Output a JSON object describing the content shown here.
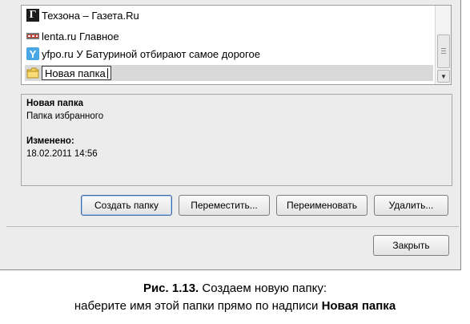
{
  "bookmarks": {
    "items": [
      {
        "label": "Техзона – Газета.Ru",
        "icon": "gazeta-favicon",
        "icon_glyph": "Г"
      },
      {
        "label": "lenta.ru Главное",
        "icon": "lenta-favicon"
      },
      {
        "label": "yfpo.ru У Батуриной отбирают самое дорогое",
        "icon": "yandex-favicon",
        "icon_glyph": "Y"
      }
    ],
    "new_folder": {
      "value": "Новая папка",
      "icon": "folder-icon"
    }
  },
  "details": {
    "name": "Новая папка",
    "description": "Папка избранного",
    "modified_label": "Изменено:",
    "modified_value": "18.02.2011 14:56"
  },
  "buttons": {
    "create": "Создать папку",
    "move": "Переместить...",
    "rename": "Переименовать",
    "delete": "Удалить...",
    "close": "Закрыть"
  },
  "caption": {
    "figure": "Рис. 1.13.",
    "line1_rest": " Создаем новую папку:",
    "line2_prefix": "наберите имя этой папки прямо по надписи ",
    "line2_bold": "Новая папка"
  },
  "colors": {
    "window_bg": "#ececec",
    "selection_bg": "#d9d9d9",
    "default_button_border": "#3b6ea8"
  }
}
